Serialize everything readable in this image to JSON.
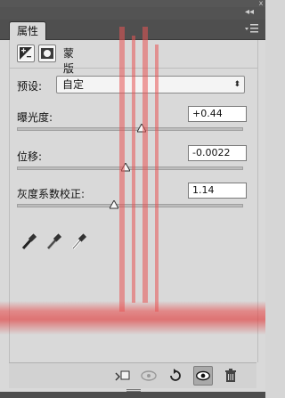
{
  "window": {
    "collapse_glyph": "◂◂",
    "close_glyph": "x"
  },
  "tabs": [
    {
      "label": "属性",
      "active": true
    }
  ],
  "panel_menu_icon": "panel-menu-icon",
  "mode_buttons": [
    {
      "icon": "exposure-adjustment-icon",
      "active": true
    },
    {
      "icon": "mask-icon",
      "active": false
    }
  ],
  "mode_label": "蒙版",
  "preset": {
    "label": "预设:",
    "value": "自定",
    "arrow": "⬍"
  },
  "fields": [
    {
      "label": "曝光度:",
      "value": "+0.44",
      "slider": 0.55
    },
    {
      "label": "位移:",
      "value": "-0.0022",
      "slider": 0.48
    },
    {
      "label": "灰度系数校正:",
      "value": "1.14",
      "slider": 0.43
    }
  ],
  "eyedroppers": [
    {
      "icon": "black-point-eyedropper-icon"
    },
    {
      "icon": "gray-point-eyedropper-icon"
    },
    {
      "icon": "white-point-eyedropper-icon"
    }
  ],
  "bottom_tools": [
    {
      "icon": "clip-to-layer-icon"
    },
    {
      "icon": "view-previous-state-icon"
    },
    {
      "icon": "reset-icon"
    },
    {
      "icon": "visibility-eye-icon"
    },
    {
      "icon": "trash-icon"
    }
  ],
  "colors": {
    "panel_bg": "#d9d9d9",
    "chrome_dark": "#4f4f4f",
    "watermark_red": "#e84a4a"
  }
}
